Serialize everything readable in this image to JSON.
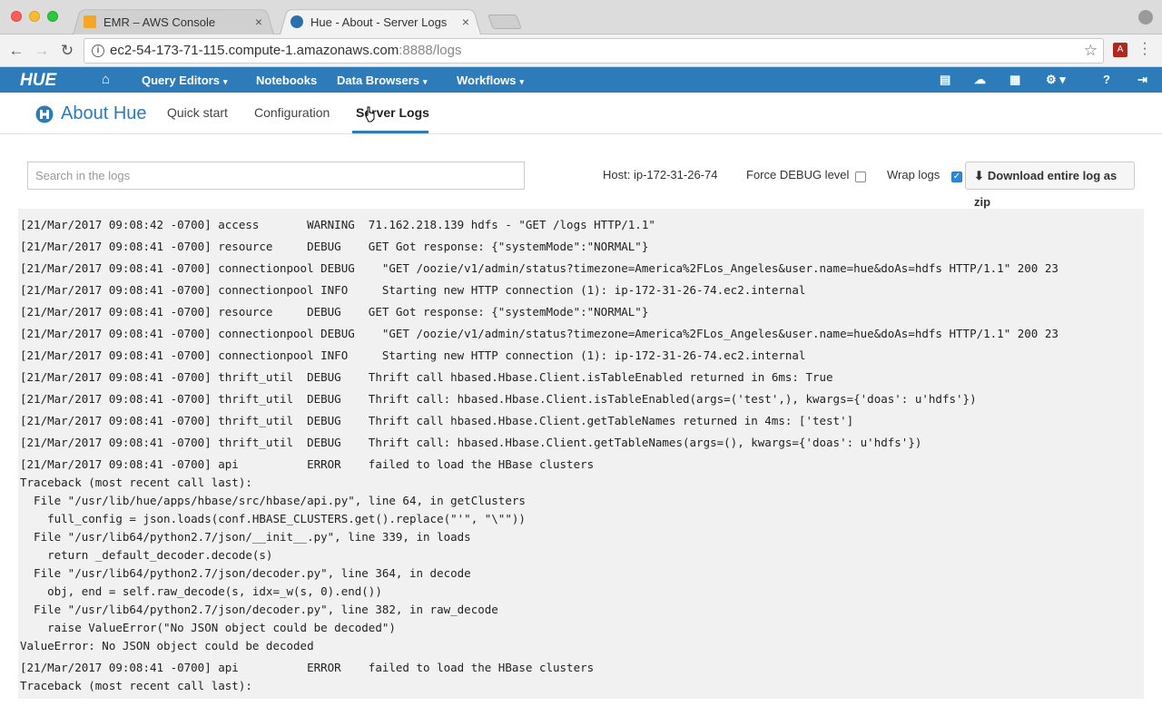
{
  "browser": {
    "tabs": [
      {
        "label": "EMR – AWS Console",
        "close": "×"
      },
      {
        "label": "Hue - About - Server Logs",
        "close": "×"
      }
    ],
    "url_host": "ec2-54-173-71-115.compute-1.amazonaws.com",
    "url_rest": ":8888/logs"
  },
  "huenav": {
    "logo": "HUE",
    "items": [
      {
        "label": "Query Editors",
        "caret": "▾"
      },
      {
        "label": "Notebooks"
      },
      {
        "label": "Data Browsers",
        "caret": "▾"
      },
      {
        "label": "Workflows",
        "caret": "▾"
      }
    ]
  },
  "subheader": {
    "title": "About Hue",
    "tabs": [
      "Quick start",
      "Configuration",
      "Server Logs"
    ]
  },
  "controls": {
    "search_placeholder": "Search in the logs",
    "host_label": "Host: ip-172-31-26-74",
    "force_debug_label": "Force DEBUG level",
    "force_debug_checked": false,
    "wrap_logs_label": "Wrap logs",
    "wrap_logs_checked": true,
    "download_label": "Download entire log as zip"
  },
  "logs": [
    "[21/Mar/2017 09:08:42 -0700] access       WARNING  71.162.218.139 hdfs - \"GET /logs HTTP/1.1\"",
    "[21/Mar/2017 09:08:41 -0700] resource     DEBUG    GET Got response: {\"systemMode\":\"NORMAL\"}",
    "[21/Mar/2017 09:08:41 -0700] connectionpool DEBUG    \"GET /oozie/v1/admin/status?timezone=America%2FLos_Angeles&user.name=hue&doAs=hdfs HTTP/1.1\" 200 23",
    "[21/Mar/2017 09:08:41 -0700] connectionpool INFO     Starting new HTTP connection (1): ip-172-31-26-74.ec2.internal",
    "[21/Mar/2017 09:08:41 -0700] resource     DEBUG    GET Got response: {\"systemMode\":\"NORMAL\"}",
    "[21/Mar/2017 09:08:41 -0700] connectionpool DEBUG    \"GET /oozie/v1/admin/status?timezone=America%2FLos_Angeles&user.name=hue&doAs=hdfs HTTP/1.1\" 200 23",
    "[21/Mar/2017 09:08:41 -0700] connectionpool INFO     Starting new HTTP connection (1): ip-172-31-26-74.ec2.internal",
    "[21/Mar/2017 09:08:41 -0700] thrift_util  DEBUG    Thrift call hbased.Hbase.Client.isTableEnabled returned in 6ms: True",
    "[21/Mar/2017 09:08:41 -0700] thrift_util  DEBUG    Thrift call: hbased.Hbase.Client.isTableEnabled(args=('test',), kwargs={'doas': u'hdfs'})",
    "[21/Mar/2017 09:08:41 -0700] thrift_util  DEBUG    Thrift call hbased.Hbase.Client.getTableNames returned in 4ms: ['test']",
    "[21/Mar/2017 09:08:41 -0700] thrift_util  DEBUG    Thrift call: hbased.Hbase.Client.getTableNames(args=(), kwargs={'doas': u'hdfs'})",
    "[21/Mar/2017 09:08:41 -0700] api          ERROR    failed to load the HBase clusters",
    "Traceback (most recent call last):",
    "  File \"/usr/lib/hue/apps/hbase/src/hbase/api.py\", line 64, in getClusters",
    "    full_config = json.loads(conf.HBASE_CLUSTERS.get().replace(\"'\", \"\\\"\"))",
    "  File \"/usr/lib64/python2.7/json/__init__.py\", line 339, in loads",
    "    return _default_decoder.decode(s)",
    "  File \"/usr/lib64/python2.7/json/decoder.py\", line 364, in decode",
    "    obj, end = self.raw_decode(s, idx=_w(s, 0).end())",
    "  File \"/usr/lib64/python2.7/json/decoder.py\", line 382, in raw_decode",
    "    raise ValueError(\"No JSON object could be decoded\")",
    "ValueError: No JSON object could be decoded",
    "[21/Mar/2017 09:08:41 -0700] api          ERROR    failed to load the HBase clusters",
    "Traceback (most recent call last):"
  ],
  "colors": {
    "hue_blue": "#2d7bb9",
    "log_bg": "#f1f1f1"
  }
}
